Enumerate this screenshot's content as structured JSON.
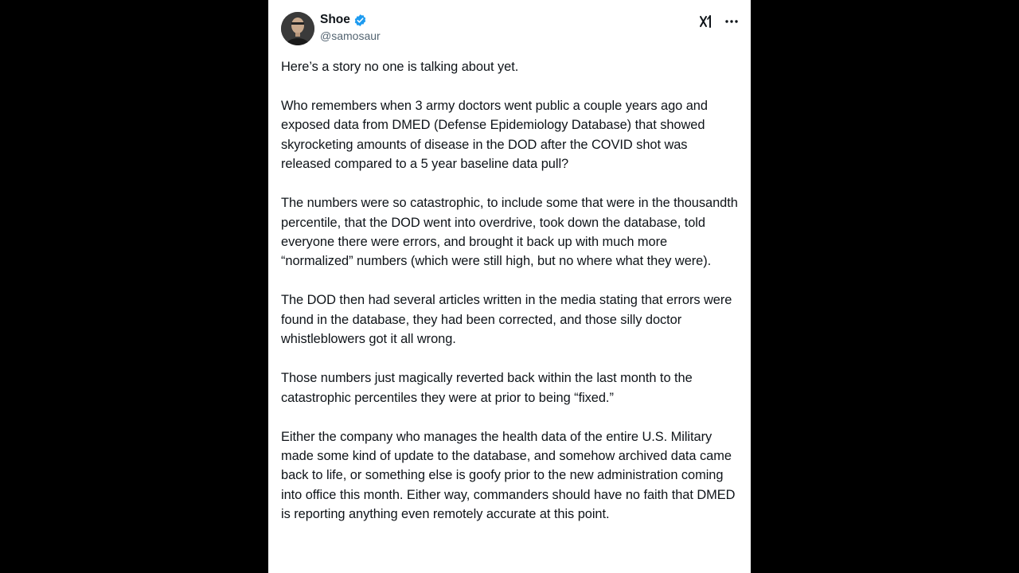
{
  "post": {
    "author": {
      "display_name": "Shoe",
      "handle": "@samosaur",
      "verified": true,
      "verified_color": "#1d9bf0"
    },
    "icons": {
      "avatar": "avatar",
      "verified": "verified-badge-icon",
      "grok": "grok-icon",
      "more": "more-options-icon"
    },
    "paragraphs": [
      "Here’s a story no one is talking about yet.",
      "Who remembers when 3 army doctors went public a couple years ago and exposed data from DMED (Defense Epidemiology Database) that showed skyrocketing amounts of disease in the DOD after the COVID shot was released compared to a 5 year baseline data pull?",
      "The numbers were so catastrophic, to include some that were in the thousandth percentile, that the DOD went into overdrive, took down the database, told everyone there were errors, and brought it back up with much more “normalized” numbers (which were still high, but no where what they were).",
      "The DOD then had several articles written in the media stating that errors were found in the database, they had been corrected, and those silly doctor whistleblowers got it all wrong.",
      "Those numbers just magically reverted back within the last month to the catastrophic percentiles they were at prior to being “fixed.”",
      "Either the company who manages the health data of the entire U.S. Military made some kind of update to the database, and somehow archived data came back to life, or something else is goofy prior to the new administration coming into office this month. Either way, commanders should have no faith that DMED is reporting anything even remotely accurate at this point."
    ]
  },
  "colors": {
    "background": "#000000",
    "card": "#ffffff",
    "text": "#0f1419",
    "secondary_text": "#536471"
  }
}
